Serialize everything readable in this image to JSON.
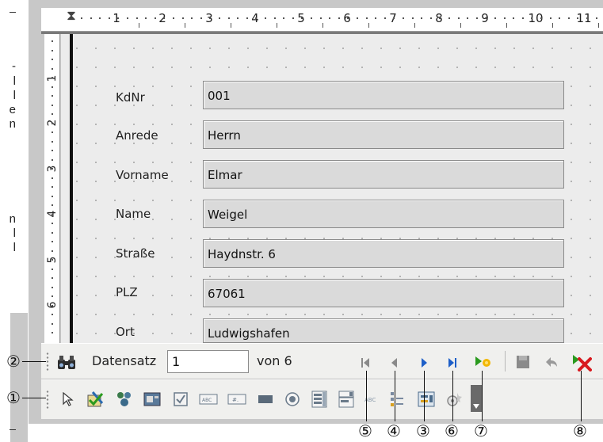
{
  "ruler": {
    "top_labels": [
      "1",
      "2",
      "3",
      "4",
      "5",
      "6",
      "7",
      "8",
      "9",
      "10",
      "11"
    ],
    "side_labels": [
      "1",
      "2",
      "3",
      "4",
      "5",
      "6"
    ]
  },
  "form": {
    "fields": [
      {
        "label": "KdNr",
        "value": "001"
      },
      {
        "label": "Anrede",
        "value": "Herrn"
      },
      {
        "label": "Vorname",
        "value": "Elmar"
      },
      {
        "label": "Name",
        "value": "Weigel"
      },
      {
        "label": "Straße",
        "value": "Haydnstr. 6"
      },
      {
        "label": "PLZ",
        "value": "67061"
      },
      {
        "label": "Ort",
        "value": "Ludwigshafen"
      }
    ]
  },
  "navigation_toolbar": {
    "record_label": "Datensatz",
    "record_value": "1",
    "total_label": "von 6",
    "icons": [
      "find-record-icon",
      "first-record-icon",
      "previous-record-icon",
      "next-record-icon",
      "last-record-icon",
      "new-record-icon",
      "save-record-icon",
      "undo-icon",
      "delete-record-icon"
    ]
  },
  "form_controls_toolbar": {
    "icons": [
      "select-pointer-icon",
      "design-mode-icon",
      "wizard-icon",
      "form-properties-icon",
      "checkbox-icon",
      "textbox-icon",
      "formatted-field-icon",
      "push-button-icon",
      "option-button-icon",
      "list-box-icon",
      "combo-box-icon",
      "label-field-icon",
      "navigator-icon",
      "form-design-icon",
      "automatic-control-focus-icon",
      "more-controls-icon"
    ]
  },
  "callouts": {
    "nav_toolbar": "②",
    "form_controls_toolbar": "①",
    "next_record": "③",
    "previous_record": "④",
    "first_record": "⑤",
    "last_record": "⑥",
    "new_record": "⑦",
    "delete_record": "⑧"
  },
  "colors": {
    "nav_green": "#2a9a1e",
    "nav_blue": "#1e5fc8",
    "nav_grey": "#7a7a7a",
    "delete_red": "#d8191e",
    "new_star": "#f2b705"
  }
}
